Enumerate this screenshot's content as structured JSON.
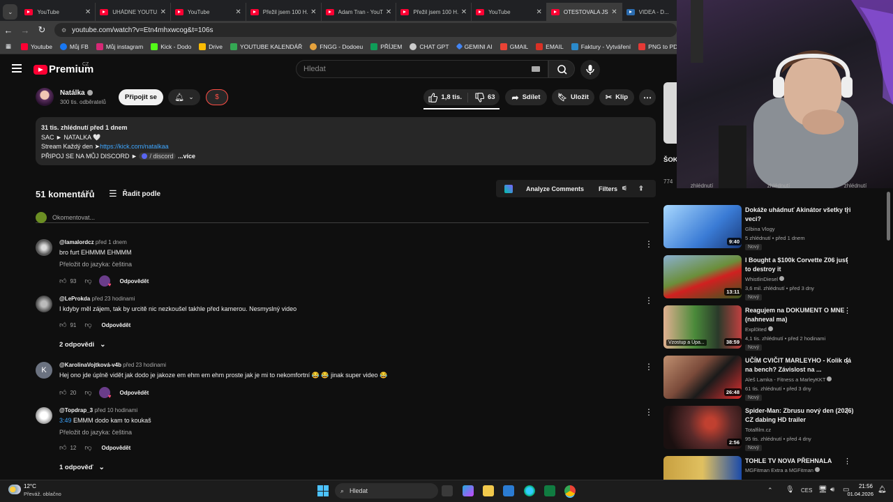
{
  "browser": {
    "tabs": [
      {
        "title": "YouTube",
        "active": false
      },
      {
        "title": "UHÁDNE YOUTU...",
        "active": false
      },
      {
        "title": "YouTube",
        "active": false
      },
      {
        "title": "Přežil jsem 100 H...",
        "active": false
      },
      {
        "title": "Adam Tran - YouT...",
        "active": false
      },
      {
        "title": "Přežil jsem 100 H...",
        "active": false
      },
      {
        "title": "YouTube",
        "active": false
      },
      {
        "title": "OTESTOVALA JSEM...",
        "active": true
      },
      {
        "title": "VIDEA - D...",
        "active": false
      }
    ],
    "url": "youtube.com/watch?v=Etn4mhxwcog&t=106s",
    "bookmarks": [
      {
        "label": "Youtube",
        "color": "#ff0033"
      },
      {
        "label": "Můj FB",
        "color": "#1877f2"
      },
      {
        "label": "Můj instagram",
        "color": "#d62976"
      },
      {
        "label": "Kick - Dodo",
        "color": "#53fc18"
      },
      {
        "label": "Drive",
        "color": "#fbbc04"
      },
      {
        "label": "YOUTUBE KALENDÁŘ",
        "color": "#34a853"
      },
      {
        "label": "FNGG - Dodoeu",
        "color": "#e6a23c"
      },
      {
        "label": "PŘÍJEM",
        "color": "#0f9d58"
      },
      {
        "label": "CHAT GPT",
        "color": "#cccccc"
      },
      {
        "label": "GEMINI AI",
        "color": "#4285f4"
      },
      {
        "label": "GMAIL",
        "color": "#ea4335"
      },
      {
        "label": "EMAIL",
        "color": "#d93025"
      },
      {
        "label": "Faktury - Vytváření",
        "color": "#2b8acb"
      },
      {
        "label": "PNG to PDF",
        "color": "#e53935"
      }
    ]
  },
  "yt": {
    "brand": "Premium",
    "region": "CZ",
    "search_placeholder": "Hledat"
  },
  "channel": {
    "name": "Natálka",
    "subscribers": "300 tis. odběratelů",
    "join_label": "Připojit se",
    "dollar": "$",
    "likes": "1,8 tis.",
    "dislikes": "63",
    "share": "Sdílet",
    "save": "Uložit",
    "clip": "Klip"
  },
  "description": {
    "stats": "31 tis. zhlédnutí  před 1 dnem",
    "line1": "SAC ► NATALKA 🤍",
    "line2_prefix": "Stream Každý den ➤",
    "line2_link": "https://kick.com/natalkaa",
    "line3": "PŘIPOJ SE NA MŮJ DISCORD ► ",
    "line3_chip": "/ discord",
    "more": "...více"
  },
  "comments_header": {
    "count": "51 komentářů",
    "sort": "Řadit podle",
    "analyze": "Analyze Comments",
    "filters": "Filters",
    "add_placeholder": "Okomentovat..."
  },
  "comments": [
    {
      "user": "@lamalordcz",
      "time": "před 1 dnem",
      "text": "bro furt EHMMM EHMMM",
      "translate": "Přeložit do jazyka: čeština",
      "likes": "93",
      "reply": "Odpovědět",
      "replies": ""
    },
    {
      "user": "@LeProkda",
      "time": "před 23 hodinami",
      "text": "I kdyby měl zájem, tak by urcitě nic nezkoušel takhle před kamerou. Nesmyslný video",
      "translate": "",
      "likes": "91",
      "reply": "Odpovědět",
      "replies": "2 odpovědi"
    },
    {
      "user": "@KarolinaVojtková-v4b",
      "time": "před 23 hodinami",
      "text": "Hej ono jde úplně vidět jak dodo je jakoze em ehm em ehm proste jak je mi to nekomfortní 😂 😂 jinak super video 😂",
      "translate": "",
      "likes": "20",
      "reply": "Odpovědět",
      "replies": "",
      "avatar_letter": "K"
    },
    {
      "user": "@Topdrap_3",
      "time": "před 10 hodinami",
      "timestamp": "3:49",
      "text": "EMMM dodo kam to koukaš",
      "translate": "Přeložit do jazyka: čeština",
      "likes": "12",
      "reply": "Odpovědět",
      "replies": "1 odpověď"
    }
  ],
  "sidebar": {
    "partial_title": "ŠOK PRA...",
    "partial_views": "774",
    "views_row": [
      "zhlédnutí",
      "zhlédnutí",
      "zhlédnutí"
    ],
    "videos": [
      {
        "title": "Dokáže uhádnuť Akinátor všetky tri veci?",
        "channel": "Glbina Vlogy",
        "meta": "5 zhlédnutí • před 1 dnem",
        "badge": "Nový",
        "duration": "9:40",
        "thumb": "#3a7bd5"
      },
      {
        "title": "I Bought a $100k Corvette Z06 just to destroy it",
        "channel": "WhistlinDiesel",
        "meta": "3,6 mil. zhlédnutí • před 3 dny",
        "badge": "Nový",
        "duration": "13:11",
        "thumb": "#6b8e3a"
      },
      {
        "title": "Reagujem na DOKUMENT O MNE (nahneval ma)",
        "channel": "Expl0ited",
        "meta": "4,1 tis. zhlédnutí • před 2 hodinami",
        "badge": "Nový",
        "duration": "38:59",
        "overlay": "Vzostup a Úpa...",
        "thumb": "#4a5a3a"
      },
      {
        "title": "UČÍM CVIČIT MARLEYHO - Kolik dá na bench? Závislost na ...",
        "channel": "Aleš Lamka - Fitness a MarleyKKT",
        "meta": "61 tis. zhlédnutí • před 3 dny",
        "badge": "Nový",
        "duration": "26:48",
        "thumb": "#7a4a3a"
      },
      {
        "title": "Spider-Man: Zbrusu nový den (2026) CZ dabing HD trailer",
        "channel": "Totalfilm.cz",
        "meta": "95 tis. zhlédnutí • před 4 dny",
        "badge": "Nový",
        "duration": "2:56",
        "thumb": "#5a2a2a"
      },
      {
        "title": "TOHLE TV NOVA PŘEHNALA",
        "channel": "MGFitman Extra a MGFitman",
        "meta": "",
        "badge": "",
        "duration": "",
        "thumb": "#c8a040"
      }
    ]
  },
  "taskbar": {
    "temp": "12°C",
    "weather": "Převáž. oblačno",
    "search": "Hledat",
    "lang": "CES",
    "time": "21:56",
    "date": "01.04.2026"
  }
}
